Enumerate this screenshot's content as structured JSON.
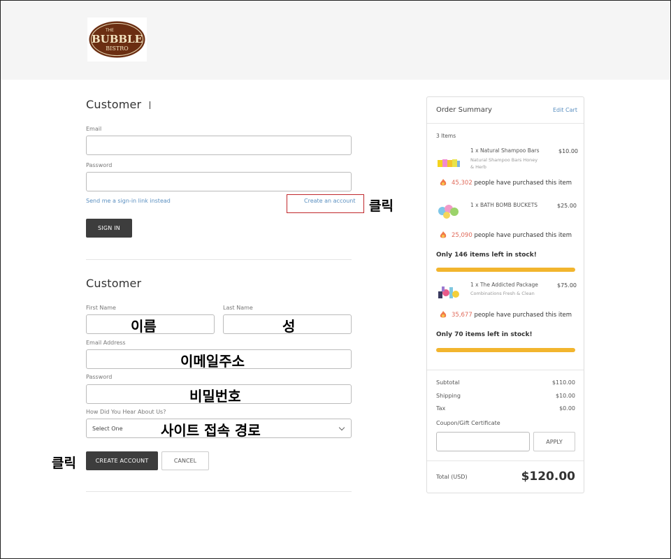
{
  "brand": {
    "logo_top": "THE",
    "logo_main": "BUBBLE",
    "logo_sub": "BISTRO"
  },
  "signin": {
    "title": "Customer",
    "email_label": "Email",
    "password_label": "Password",
    "signin_link": "Send me a sign-in link instead",
    "create_link": "Create an account",
    "signin_button": "SIGN IN"
  },
  "register": {
    "title": "Customer",
    "first_name_label": "First Name",
    "last_name_label": "Last Name",
    "email_label": "Email Address",
    "password_label": "Password",
    "hear_label": "How Did You Hear About Us?",
    "hear_selected": "Select One",
    "create_button": "CREATE ACCOUNT",
    "cancel_button": "CANCEL"
  },
  "annotations": {
    "click_create_link": "클릭",
    "click_create_button": "클릭",
    "first_name": "이름",
    "last_name": "성",
    "email": "이메일주소",
    "password": "비밀번호",
    "hear": "사이트  접속  경로"
  },
  "summary": {
    "title": "Order Summary",
    "edit_cart": "Edit Cart",
    "item_count": "3 Items",
    "purchased_suffix": "people have purchased this item",
    "items": [
      {
        "name": "1 x Natural Shampoo Bars",
        "sub1": "Natural Shampoo Bars Honey",
        "sub2": "& Herb",
        "price": "$10.00",
        "purchased": "45,302",
        "stock": ""
      },
      {
        "name": "1 x BATH BOMB BUCKETS",
        "sub1": "",
        "sub2": "",
        "price": "$25.00",
        "purchased": "25,090",
        "stock": "Only 146 items left in stock!"
      },
      {
        "name": "1 x The Addicted Package",
        "sub1": "Combinations Fresh & Clean",
        "sub2": "",
        "price": "$75.00",
        "purchased": "35,677",
        "stock": "Only 70 items left in stock!"
      }
    ],
    "subtotal_label": "Subtotal",
    "subtotal": "$110.00",
    "shipping_label": "Shipping",
    "shipping": "$10.00",
    "tax_label": "Tax",
    "tax": "$0.00",
    "coupon_label": "Coupon/Gift Certificate",
    "apply_button": "APPLY",
    "total_label": "Total (USD)",
    "total": "$120.00"
  },
  "colors": {
    "accent_link": "#5a8fc0",
    "dark_button": "#3d3d3d",
    "stock_bar": "#f2b52e",
    "purchase_count": "#e06a5a",
    "annotation_box": "#c0282c"
  },
  "icons": {
    "flame": "fire-icon",
    "select": "chevron-down-icon"
  }
}
